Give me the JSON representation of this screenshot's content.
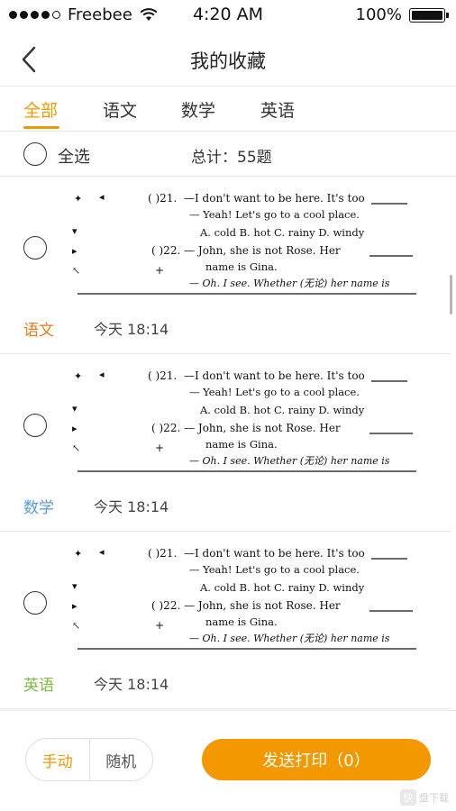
{
  "status_bar": {
    "carrier": "Freebee",
    "time": "4:20 AM",
    "battery": "100%"
  },
  "nav": {
    "title": "我的收藏"
  },
  "tabs": [
    {
      "label": "全部"
    },
    {
      "label": "语文"
    },
    {
      "label": "数学"
    },
    {
      "label": "英语"
    }
  ],
  "select": {
    "all_label": "全选",
    "total_label": "总计：55题"
  },
  "question_text": {
    "q21": "—I don't want to be here. It's too",
    "q21b": "— Yeah! Let's go to a cool place.",
    "q21_opts": "A. cold   B. hot   C. rainy  D. windy",
    "q22": "( )22. — John, she is not Rose. Her",
    "q22b": "name is Gina.",
    "q22c": "— Oh. I see. Whether (无论) her name is",
    "q21_num": "( )21."
  },
  "items": [
    {
      "subject": "语文",
      "time": "今天 18:14",
      "color": "#f07a19"
    },
    {
      "subject": "数学",
      "time": "今天 18:14",
      "color": "#5b9bd5"
    },
    {
      "subject": "英语",
      "time": "今天 18:14",
      "color": "#7dbb42"
    }
  ],
  "bottom": {
    "mode_manual": "手动",
    "mode_random": "随机",
    "print_label": "发送打印（0）"
  },
  "watermark": {
    "logo": "快",
    "text": "盘下载"
  },
  "colors": {
    "accent": "#f39800"
  }
}
